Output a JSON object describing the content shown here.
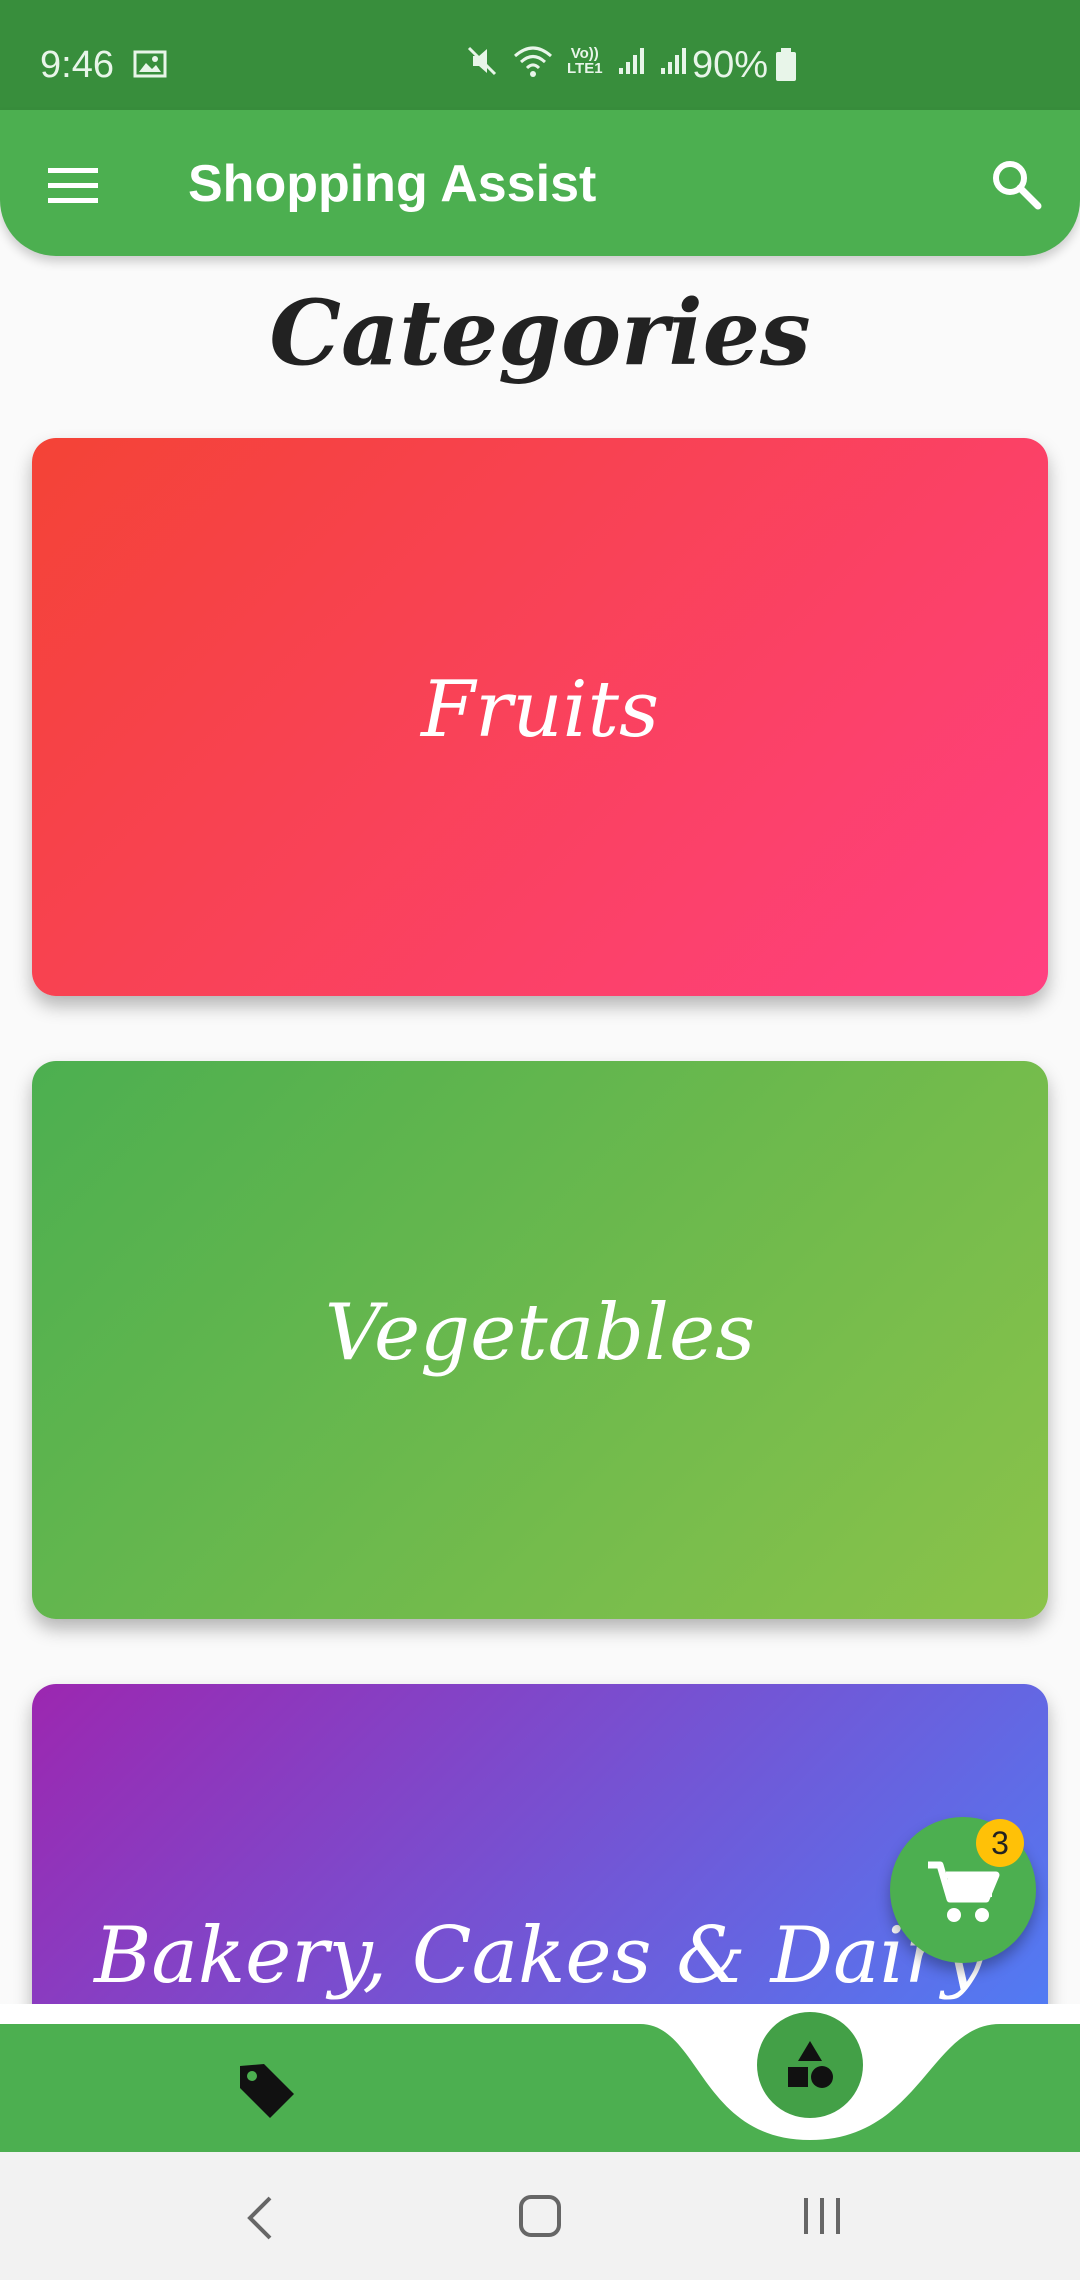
{
  "status_bar": {
    "time": "9:46",
    "battery": "90%",
    "icons": [
      "image-icon",
      "mute-icon",
      "wifi-icon",
      "volte-icon",
      "signal-icon",
      "signal-icon",
      "battery-icon"
    ],
    "volte_text": "Vo))",
    "lte_text": "LTE1"
  },
  "app_bar": {
    "title": "Shopping Assist",
    "menu_icon": "menu-icon",
    "search_icon": "search-icon",
    "color": "#4CAF50"
  },
  "page": {
    "heading": "Categories"
  },
  "categories": [
    {
      "label": "Fruits",
      "gradient": [
        "#F44336",
        "#FF4081"
      ]
    },
    {
      "label": "Vegetables",
      "gradient": [
        "#4CAF50",
        "#8BC34A"
      ]
    },
    {
      "label": "Bakery, Cakes & Dairy",
      "gradient": [
        "#9C27B0",
        "#448AFF"
      ]
    }
  ],
  "cart": {
    "count": "3",
    "icon": "cart-icon",
    "badge_color": "#FFC107"
  },
  "bottom_nav": {
    "left_icon": "tag-icon",
    "center_icon": "shapes-icon"
  },
  "system_nav": {
    "buttons": [
      "back-icon",
      "home-icon",
      "recents-icon"
    ]
  }
}
